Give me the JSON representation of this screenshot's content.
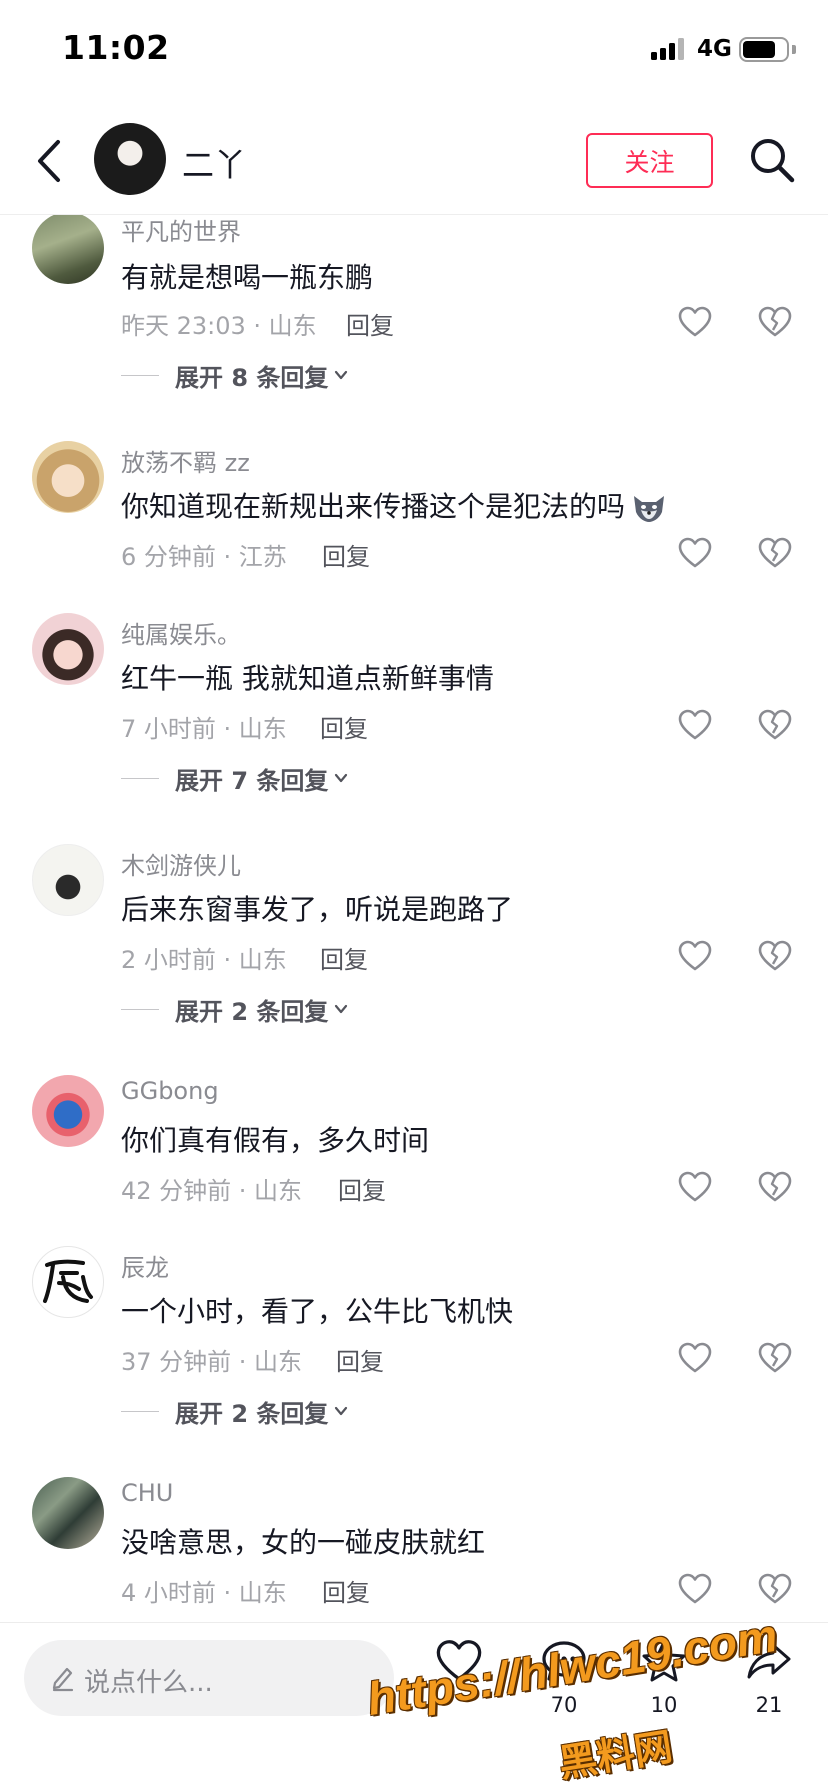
{
  "status_bar": {
    "time": "11:02",
    "network": "4G",
    "battery_level": 0.75
  },
  "header": {
    "user_name": "二丫",
    "follow_label": "关注"
  },
  "comments": [
    {
      "user": "平凡的世界",
      "text": "有就是想喝一瓶东鹏",
      "time": "昨天 23:03 · 山东",
      "reply": "回复",
      "expand": "展开 8 条回复"
    },
    {
      "user": "放荡不羁 zz",
      "text": "你知道现在新规出来传播这个是犯法的吗",
      "time": "6 分钟前 · 江苏",
      "reply": "回复",
      "emoji": "wolf-face-emoji"
    },
    {
      "user": "纯属娱乐。",
      "text": "红牛一瓶 我就知道点新鲜事情",
      "time": "7 小时前 · 山东",
      "reply": "回复",
      "expand": "展开 7 条回复"
    },
    {
      "user": "木剑游侠儿",
      "text": "后来东窗事发了，听说是跑路了",
      "time": "2 小时前 · 山东",
      "reply": "回复",
      "expand": "展开 2 条回复"
    },
    {
      "user": "GGbong",
      "text": "你们真有假有，多久时间",
      "time": "42 分钟前 · 山东",
      "reply": "回复"
    },
    {
      "user": "辰龙",
      "text": "一个小时，看了，公牛比飞机快",
      "time": "37 分钟前 · 山东",
      "reply": "回复",
      "expand": "展开 2 条回复"
    },
    {
      "user": "CHU",
      "text": "没啥意思，女的一碰皮肤就红",
      "time": "4 小时前 · 山东",
      "reply": "回复"
    }
  ],
  "bottom_bar": {
    "input_placeholder": "说点什么...",
    "actions": [
      {
        "icon": "heart-icon",
        "count": ""
      },
      {
        "icon": "comment-icon",
        "count": "70"
      },
      {
        "icon": "star-icon",
        "count": "10"
      },
      {
        "icon": "share-icon",
        "count": "21"
      }
    ]
  },
  "watermark": {
    "url": "https://hlwc19.com",
    "text": "黑料网"
  },
  "colors": {
    "accent": "#fe2c55",
    "text": "#161823",
    "muted": "#8a8b91",
    "watermark": "#f39a1e"
  }
}
